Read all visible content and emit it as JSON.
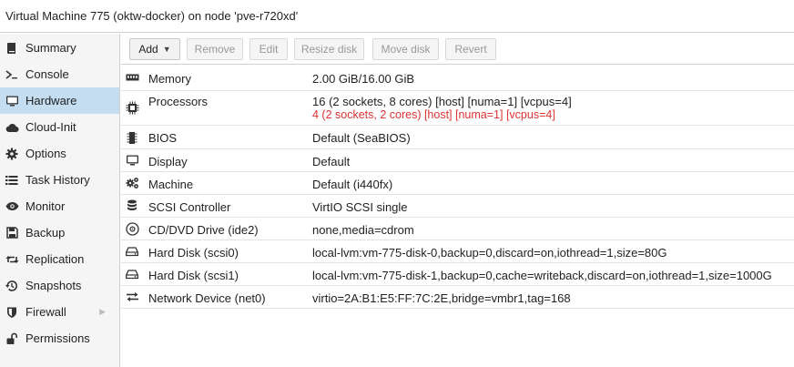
{
  "window": {
    "title": "Virtual Machine 775 (oktw-docker) on node 'pve-r720xd'"
  },
  "sidebar": {
    "items": [
      {
        "label": "Summary",
        "icon": "book-icon"
      },
      {
        "label": "Console",
        "icon": "terminal-icon"
      },
      {
        "label": "Hardware",
        "icon": "desktop-icon",
        "active": true
      },
      {
        "label": "Cloud-Init",
        "icon": "cloud-icon"
      },
      {
        "label": "Options",
        "icon": "gear-icon"
      },
      {
        "label": "Task History",
        "icon": "list-icon"
      },
      {
        "label": "Monitor",
        "icon": "eye-icon"
      },
      {
        "label": "Backup",
        "icon": "floppy-icon"
      },
      {
        "label": "Replication",
        "icon": "retweet-icon"
      },
      {
        "label": "Snapshots",
        "icon": "history-icon"
      },
      {
        "label": "Firewall",
        "icon": "shield-icon",
        "expandable": true
      },
      {
        "label": "Permissions",
        "icon": "unlock-icon"
      }
    ]
  },
  "toolbar": {
    "add_label": "Add",
    "remove_label": "Remove",
    "edit_label": "Edit",
    "resize_label": "Resize disk",
    "move_label": "Move disk",
    "revert_label": "Revert"
  },
  "hardware": {
    "rows": [
      {
        "name": "Memory",
        "icon": "memory-icon",
        "value": "2.00 GiB/16.00 GiB"
      },
      {
        "name": "Processors",
        "icon": "cpu-icon",
        "value": "16 (2 sockets, 8 cores) [host] [numa=1] [vcpus=4]",
        "pending": "4 (2 sockets, 2 cores) [host] [numa=1] [vcpus=4]"
      },
      {
        "name": "BIOS",
        "icon": "microchip-icon",
        "value": "Default (SeaBIOS)"
      },
      {
        "name": "Display",
        "icon": "desktop-icon",
        "value": "Default"
      },
      {
        "name": "Machine",
        "icon": "cogs-icon",
        "value": "Default (i440fx)"
      },
      {
        "name": "SCSI Controller",
        "icon": "database-icon",
        "value": "VirtIO SCSI single"
      },
      {
        "name": "CD/DVD Drive (ide2)",
        "icon": "cdrom-icon",
        "value": "none,media=cdrom"
      },
      {
        "name": "Hard Disk (scsi0)",
        "icon": "hdd-icon",
        "value": "local-lvm:vm-775-disk-0,backup=0,discard=on,iothread=1,size=80G"
      },
      {
        "name": "Hard Disk (scsi1)",
        "icon": "hdd-icon",
        "value": "local-lvm:vm-775-disk-1,backup=0,cache=writeback,discard=on,iothread=1,size=1000G"
      },
      {
        "name": "Network Device (net0)",
        "icon": "exchange-icon",
        "value": "virtio=2A:B1:E5:FF:7C:2E,bridge=vmbr1,tag=168"
      }
    ]
  },
  "colors": {
    "active_nav": "#c4ddf0",
    "pending_value": "#dd3333"
  }
}
